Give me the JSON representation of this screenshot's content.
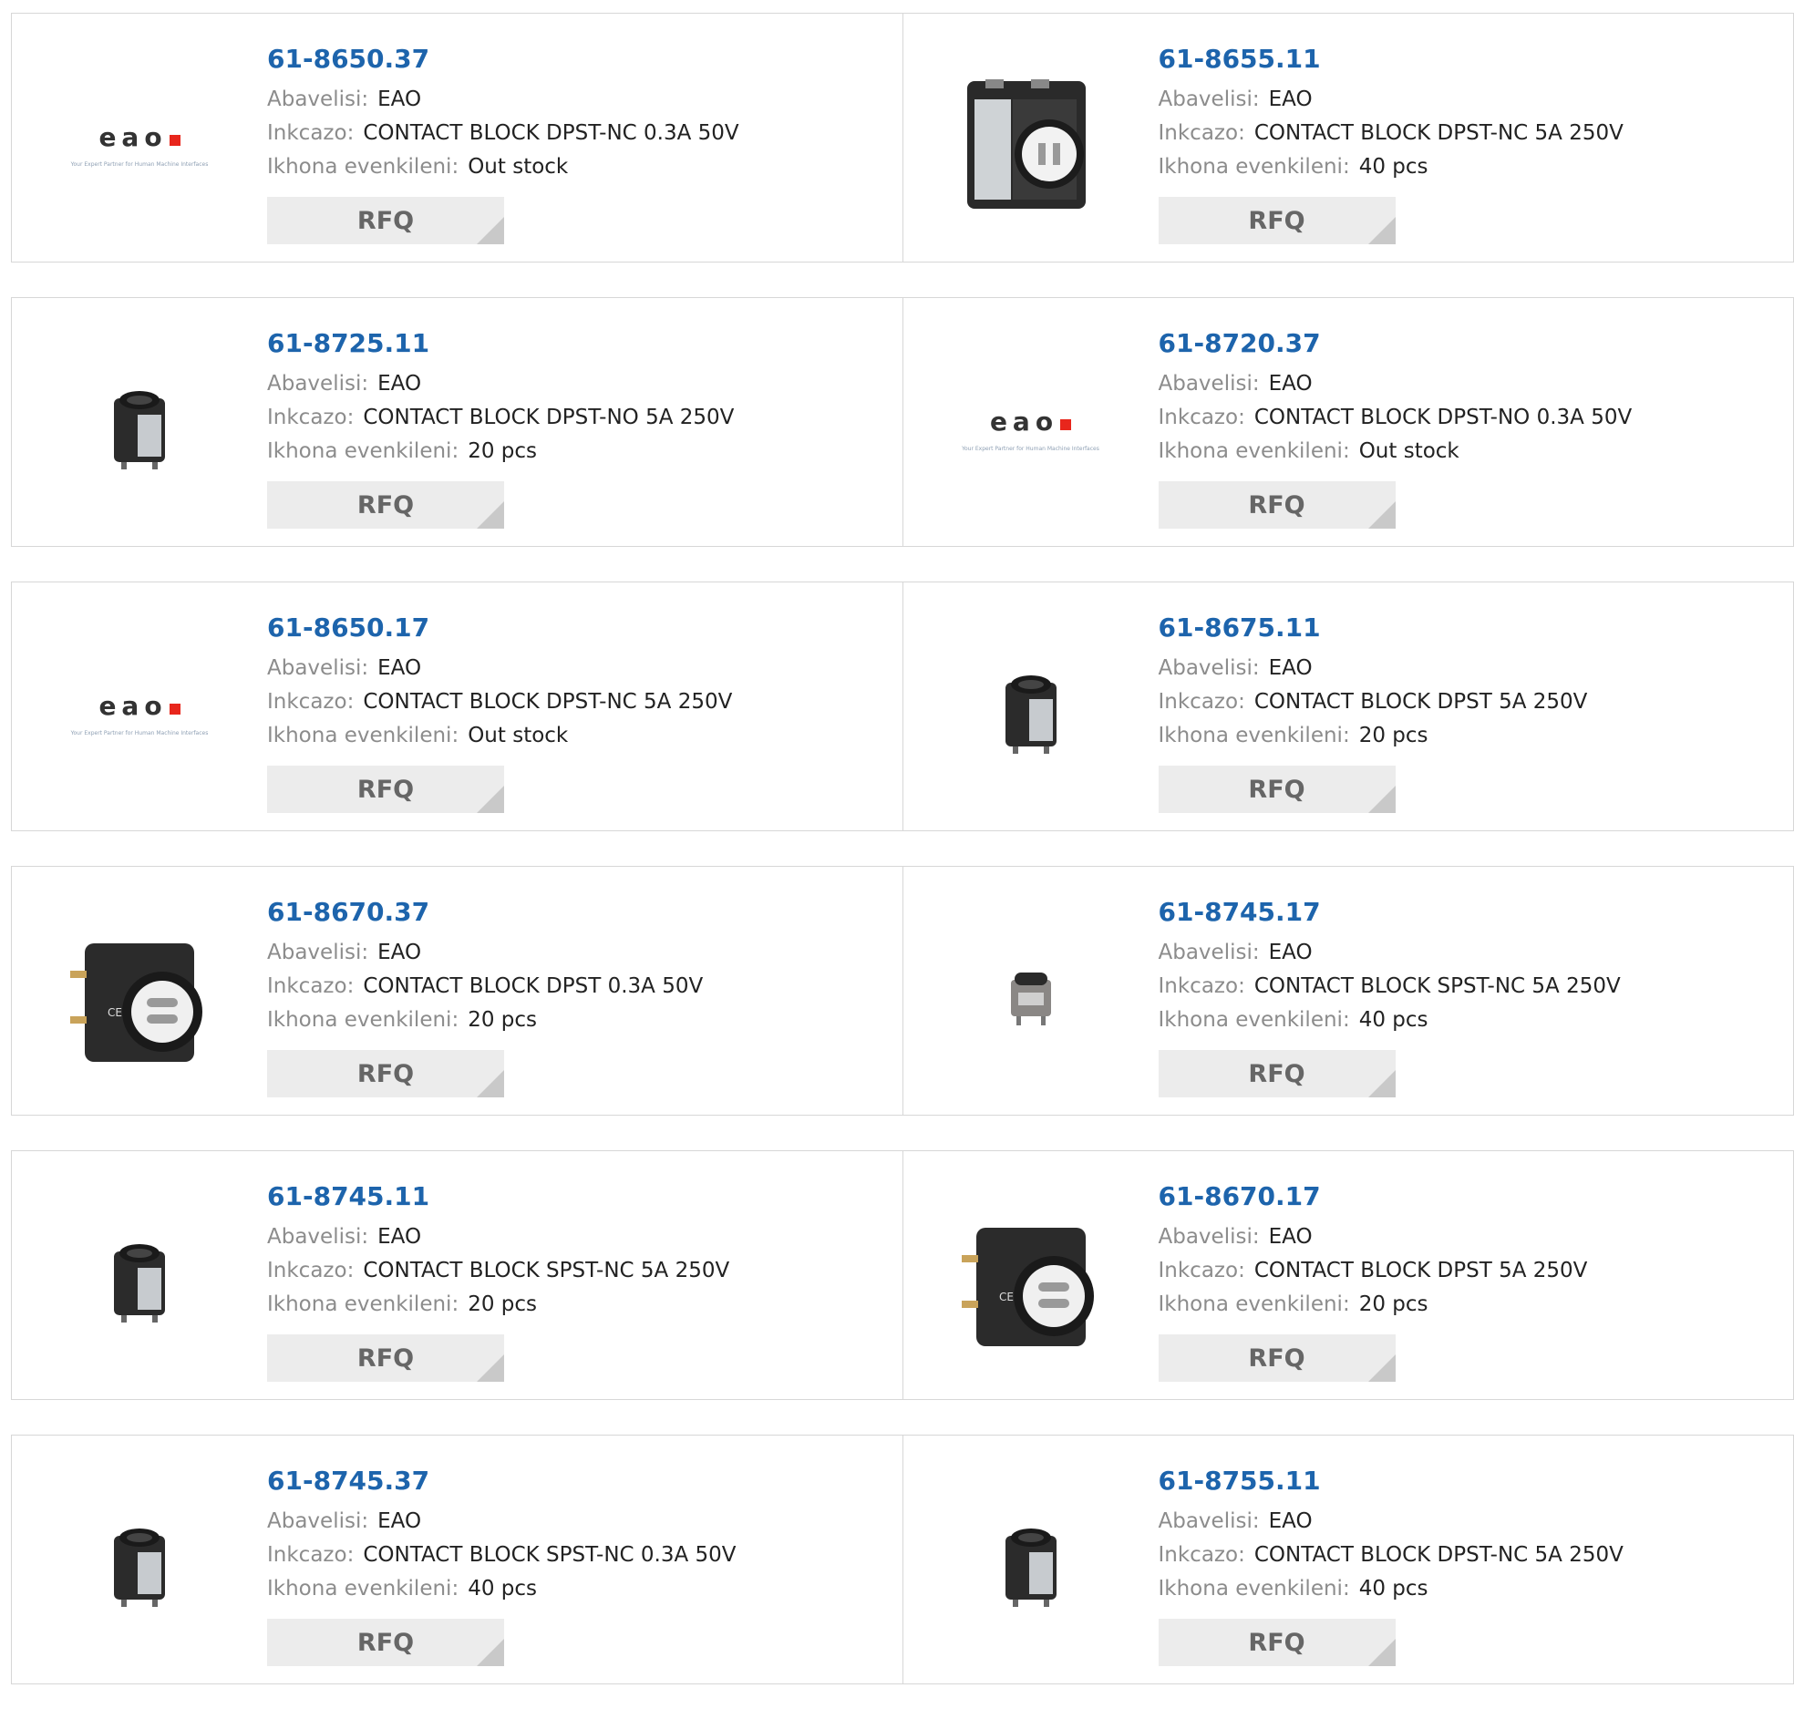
{
  "labels": {
    "manufacturer": "Abavelisi:",
    "description": "Inkcazo:",
    "stock": "Ikhona evenkileni:"
  },
  "products": [
    {
      "part": "61-8650.37",
      "manufacturer": "EAO",
      "description": "CONTACT BLOCK DPST-NC 0.3A 50V",
      "stock": "Out stock",
      "rfq": "RFQ",
      "image": "logo"
    },
    {
      "part": "61-8655.11",
      "manufacturer": "EAO",
      "description": "CONTACT BLOCK DPST-NC 5A 250V",
      "stock": "40 pcs",
      "rfq": "RFQ",
      "image": "block-large"
    },
    {
      "part": "61-8725.11",
      "manufacturer": "EAO",
      "description": "CONTACT BLOCK DPST-NO 5A 250V",
      "stock": "20 pcs",
      "rfq": "RFQ",
      "image": "block-small"
    },
    {
      "part": "61-8720.37",
      "manufacturer": "EAO",
      "description": "CONTACT BLOCK DPST-NO 0.3A 50V",
      "stock": "Out stock",
      "rfq": "RFQ",
      "image": "logo"
    },
    {
      "part": "61-8650.17",
      "manufacturer": "EAO",
      "description": "CONTACT BLOCK DPST-NC 5A 250V",
      "stock": "Out stock",
      "rfq": "RFQ",
      "image": "logo"
    },
    {
      "part": "61-8675.11",
      "manufacturer": "EAO",
      "description": "CONTACT BLOCK DPST 5A 250V",
      "stock": "20 pcs",
      "rfq": "RFQ",
      "image": "block-small"
    },
    {
      "part": "61-8670.37",
      "manufacturer": "EAO",
      "description": "CONTACT BLOCK DPST 0.3A 50V",
      "stock": "20 pcs",
      "rfq": "RFQ",
      "image": "block-round"
    },
    {
      "part": "61-8745.17",
      "manufacturer": "EAO",
      "description": "CONTACT BLOCK SPST-NC 5A 250V",
      "stock": "40 pcs",
      "rfq": "RFQ",
      "image": "block-tiny"
    },
    {
      "part": "61-8745.11",
      "manufacturer": "EAO",
      "description": "CONTACT BLOCK SPST-NC 5A 250V",
      "stock": "20 pcs",
      "rfq": "RFQ",
      "image": "block-small"
    },
    {
      "part": "61-8670.17",
      "manufacturer": "EAO",
      "description": "CONTACT BLOCK DPST 5A 250V",
      "stock": "20 pcs",
      "rfq": "RFQ",
      "image": "block-round"
    },
    {
      "part": "61-8745.37",
      "manufacturer": "EAO",
      "description": "CONTACT BLOCK SPST-NC 0.3A 50V",
      "stock": "40 pcs",
      "rfq": "RFQ",
      "image": "block-small"
    },
    {
      "part": "61-8755.11",
      "manufacturer": "EAO",
      "description": "CONTACT BLOCK DPST-NC 5A 250V",
      "stock": "40 pcs",
      "rfq": "RFQ",
      "image": "block-small"
    }
  ],
  "logo": {
    "word": "eao",
    "tagline": "Your Expert Partner for Human Machine Interfaces"
  },
  "colors": {
    "part_link": "#1d64ac",
    "logo_red": "#e8261c"
  }
}
